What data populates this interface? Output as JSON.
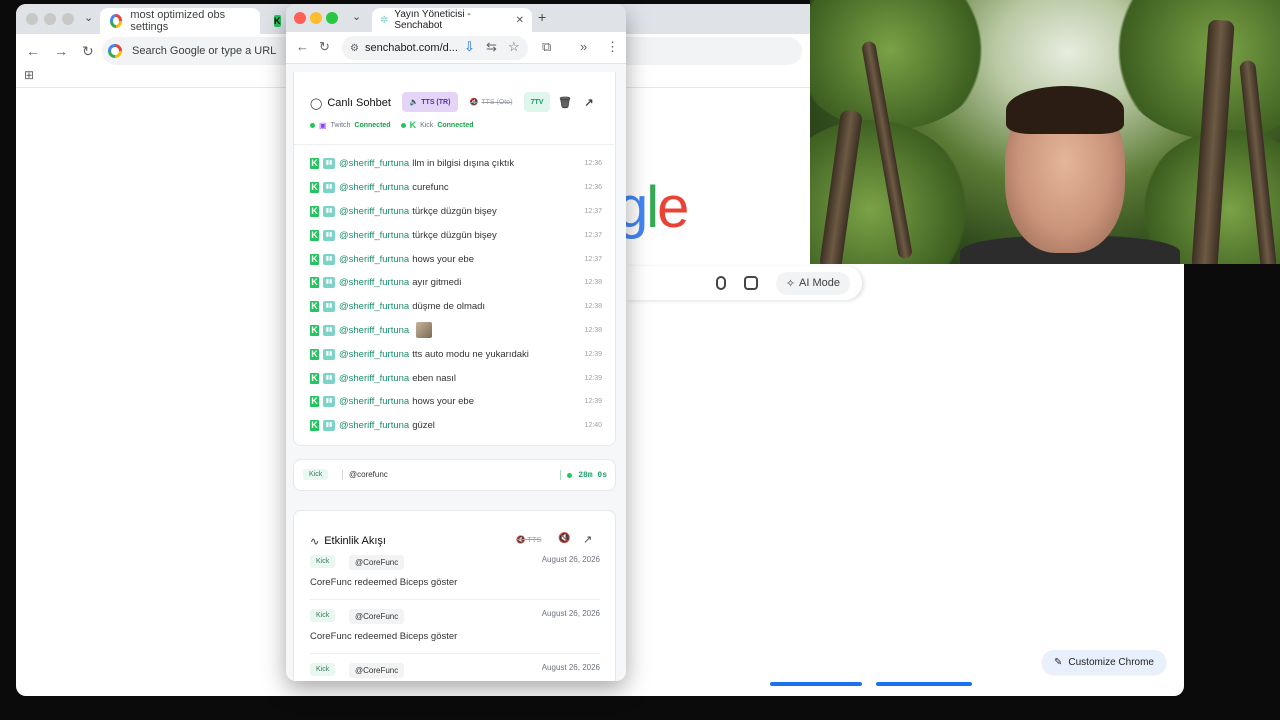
{
  "background_browser": {
    "tabs": [
      {
        "title": "most optimized obs settings"
      },
      {
        "title": ""
      }
    ],
    "omnibox_placeholder": "Search Google or type a URL",
    "logo_text": [
      "g",
      "l",
      "e"
    ],
    "ai_mode_label": "AI Mode",
    "customize_label": "Customize Chrome"
  },
  "popup": {
    "tab_title": "Yayın Yöneticisi - Senchabot",
    "url": "senchabot.com/d...",
    "chat": {
      "title": "Canlı Sohbet",
      "tts_tr_label": "TTS (TR)",
      "tts_auto_label": "TTS (Oto)",
      "seventv_label": "7TV",
      "connections": [
        {
          "platform": "Twitch",
          "state": "Connected"
        },
        {
          "platform": "Kick",
          "state": "Connected"
        }
      ],
      "messages": [
        {
          "user": "@sheriff_furtuna",
          "text": "llm in bilgisi dışına çıktık",
          "time": "12:36"
        },
        {
          "user": "@sheriff_furtuna",
          "text": "curefunc",
          "time": "12:36"
        },
        {
          "user": "@sheriff_furtuna",
          "text": "türkçe düzgün bişey",
          "time": "12:37"
        },
        {
          "user": "@sheriff_furtuna",
          "text": "türkçe düzgün bişey",
          "time": "12:37"
        },
        {
          "user": "@sheriff_furtuna",
          "text": "hows your ebe",
          "time": "12:37"
        },
        {
          "user": "@sheriff_furtuna",
          "text": "ayır gitmedi",
          "time": "12:38"
        },
        {
          "user": "@sheriff_furtuna",
          "text": "düşme de olmadı",
          "time": "12:38"
        },
        {
          "user": "@sheriff_furtuna",
          "text": "",
          "time": "12:38",
          "emote": true
        },
        {
          "user": "@sheriff_furtuna",
          "text": "tts auto modu ne yukarıdaki",
          "time": "12:39"
        },
        {
          "user": "@sheriff_furtuna",
          "text": "eben nasıl",
          "time": "12:39"
        },
        {
          "user": "@sheriff_furtuna",
          "text": "hows your ebe",
          "time": "12:39"
        },
        {
          "user": "@sheriff_furtuna",
          "text": "güzel",
          "time": "12:40"
        }
      ]
    },
    "stream_status": {
      "platform": "Kick",
      "handle": "@corefunc",
      "uptime": "28m 0s"
    },
    "events": {
      "title": "Etkinlik Akışı",
      "tts_label": "TTS",
      "items": [
        {
          "platform": "Kick",
          "user": "@CoreFunc",
          "date": "August 26, 2026",
          "text": "CoreFunc redeemed Biceps göster"
        },
        {
          "platform": "Kick",
          "user": "@CoreFunc",
          "date": "August 26, 2026",
          "text": "CoreFunc redeemed Biceps göster"
        },
        {
          "platform": "Kick",
          "user": "@CoreFunc",
          "date": "August 26, 2026",
          "text": ""
        }
      ]
    }
  },
  "colors": {
    "accent_green": "#22c55e",
    "tts_purple": "#5b2ea6",
    "google_blue": "#4285f4"
  }
}
